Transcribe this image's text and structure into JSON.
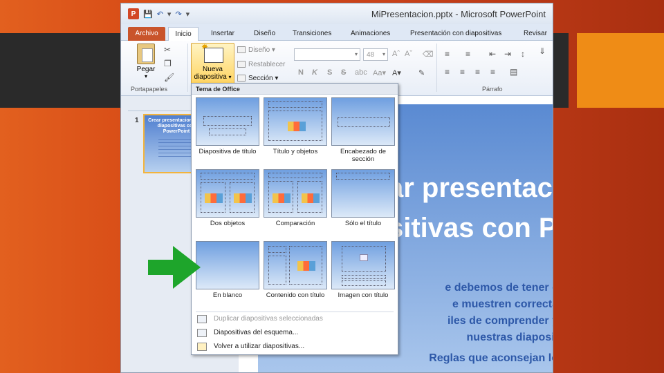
{
  "window": {
    "title": "MiPresentacion.pptx  -  Microsoft PowerPoint",
    "app_icon": "P"
  },
  "tabs": [
    "Archivo",
    "Inicio",
    "Insertar",
    "Diseño",
    "Transiciones",
    "Animaciones",
    "Presentación con diapositivas",
    "Revisar"
  ],
  "ribbon": {
    "paste_label": "Pegar",
    "clipboard_group": "Portapapeles",
    "new_slide_label_1": "Nueva",
    "new_slide_label_2": "diapositiva",
    "layout_btn": "Diseño",
    "reset_btn": "Restablecer",
    "section_btn": "Sección",
    "font_size": "48",
    "paragraph_group": "Párrafo"
  },
  "thumbnail": {
    "number": "1",
    "title": "Crear presentaciones de diapositivas con PowerPoint"
  },
  "slide": {
    "title_line1": "ar presentac",
    "title_line2": "sitivas con P",
    "body_line1": "e debemos de tener e",
    "body_line2": "e muestren correcta",
    "body_line3": "iles de comprender y",
    "body_line4": "nuestras diaposit",
    "body_line5": "Reglas que aconsejan lo"
  },
  "menu": {
    "header": "Tema de Office",
    "layouts": [
      {
        "label": "Diapositiva de título"
      },
      {
        "label": "Título y objetos"
      },
      {
        "label": "Encabezado de sección"
      },
      {
        "label": "Dos objetos"
      },
      {
        "label": "Comparación"
      },
      {
        "label": "Sólo el título"
      },
      {
        "label": "En blanco"
      },
      {
        "label": "Contenido con título"
      },
      {
        "label": "Imagen con título"
      }
    ],
    "item_duplicate": "Duplicar diapositivas seleccionadas",
    "item_outline": "Diapositivas del esquema...",
    "item_reuse": "Volver a utilizar diapositivas..."
  },
  "colors": {
    "background_orange": "#d94f18",
    "accent_orange": "#ef8c16",
    "dark_bar": "#2a2a2a",
    "arrow_green": "#1ea52b"
  }
}
